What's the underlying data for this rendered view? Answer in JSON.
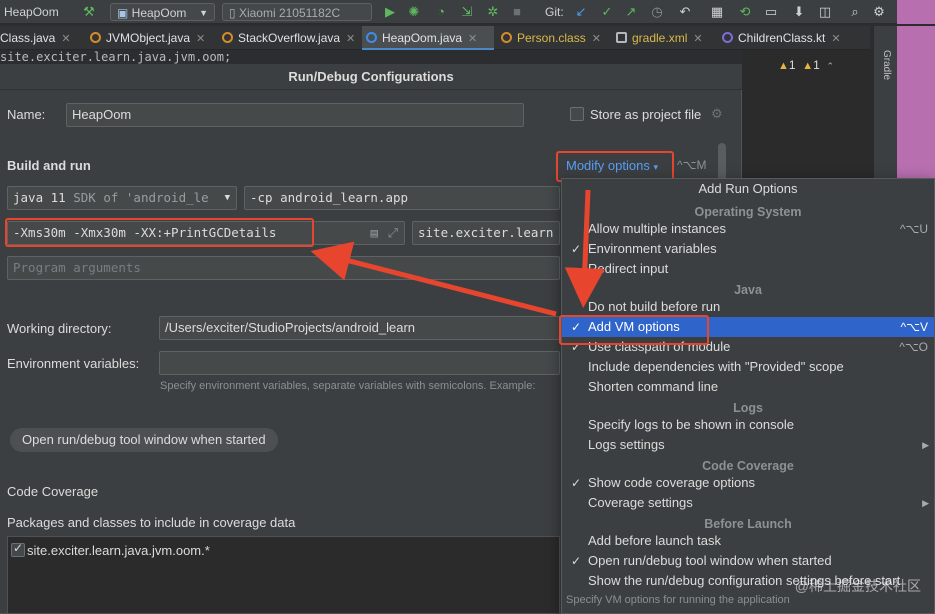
{
  "toolbar": {
    "project": "HeapOom",
    "run_config": "HeapOom",
    "device": "Xiaomi 21051182C",
    "git_label": "Git:"
  },
  "tabs": [
    {
      "label": "Class.java"
    },
    {
      "label": "JVMObject.java"
    },
    {
      "label": "StackOverflow.java"
    },
    {
      "label": "HeapOom.java"
    },
    {
      "label": "Person.class"
    },
    {
      "label": "gradle.xml"
    },
    {
      "label": "ChildrenClass.kt"
    }
  ],
  "editor_peek": "site.exciter.learn.java.jvm.oom;",
  "gradle_label": "Gradle",
  "warnings": {
    "a": "1",
    "b": "1"
  },
  "dialog": {
    "title": "Run/Debug Configurations",
    "name_label": "Name:",
    "name_value": "HeapOom",
    "store_label": "Store as project file",
    "build_and_run": "Build and run",
    "modify_options": "Modify options",
    "modify_shortcut": "^⌥M",
    "jdk_value": "java 11",
    "jdk_sdk": "SDK of 'android_le",
    "cp_value": "-cp android_learn.app",
    "vm_options": "-Xms30m -Xmx30m -XX:+PrintGCDetails",
    "main_class": "site.exciter.learn",
    "program_args_placeholder": "Program arguments",
    "working_dir_label": "Working directory:",
    "working_dir_value": "/Users/exciter/StudioProjects/android_learn",
    "env_label": "Environment variables:",
    "env_hint": "Specify environment variables, separate variables with semicolons. Example:",
    "open_tool_window": "Open run/debug tool window when started",
    "code_coverage": "Code Coverage",
    "coverage_packages_label": "Packages and classes to include in coverage data",
    "coverage_package": "site.exciter.learn.java.jvm.oom.*"
  },
  "popup": {
    "title": "Add Run Options",
    "groups": {
      "os": "Operating System",
      "java": "Java",
      "logs": "Logs",
      "coverage": "Code Coverage",
      "before_launch": "Before Launch"
    },
    "items": {
      "allow_multiple": "Allow multiple instances",
      "allow_multiple_sc": "^⌥U",
      "env_vars": "Environment variables",
      "redirect_input": "Redirect input",
      "no_build": "Do not build before run",
      "add_vm": "Add VM options",
      "add_vm_sc": "^⌥V",
      "classpath": "Use classpath of module",
      "classpath_sc": "^⌥O",
      "include_deps": "Include dependencies with \"Provided\" scope",
      "shorten_cmd": "Shorten command line",
      "specify_logs": "Specify logs to be shown in console",
      "logs_settings": "Logs settings",
      "show_coverage": "Show code coverage options",
      "coverage_settings": "Coverage settings",
      "add_before_launch": "Add before launch task",
      "open_tool_window": "Open run/debug tool window when started",
      "show_settings": "Show the run/debug configuration settings before start"
    },
    "footer": "Specify VM options for running the application"
  },
  "watermark": "@稀土掘金技术社区",
  "colors": {
    "annotation_red": "#e8452f",
    "highlight_blue": "#2f65ca",
    "link_blue": "#589df6"
  }
}
